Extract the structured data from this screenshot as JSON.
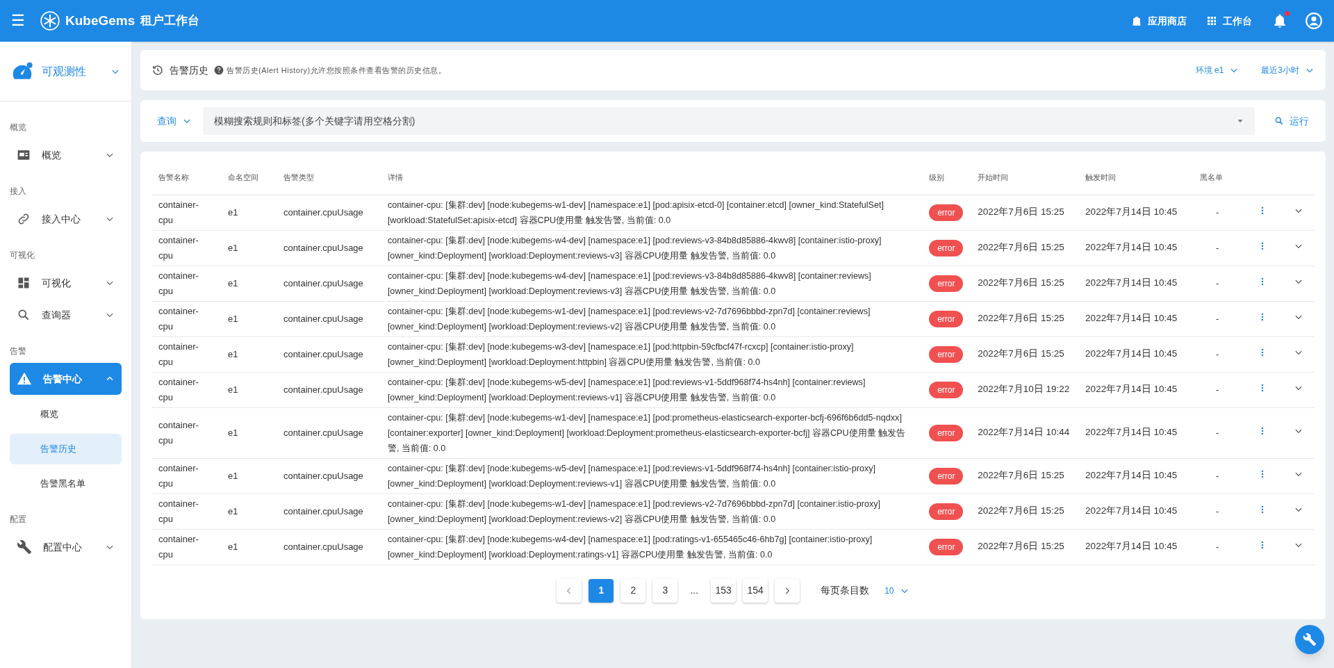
{
  "header": {
    "menu_icon": "☰",
    "logo_text": "KubeGems",
    "title": "租户工作台",
    "actions": [
      {
        "kind": "store",
        "label": "应用商店"
      },
      {
        "kind": "grid",
        "label": "工作台"
      }
    ],
    "notification_badge": true
  },
  "sidebar": {
    "module": "可观测性",
    "sections": [
      {
        "heading": "概览",
        "items": [
          {
            "kind": "overview",
            "label": "概览",
            "expanded": false
          }
        ]
      },
      {
        "heading": "接入",
        "items": [
          {
            "kind": "link",
            "label": "接入中心",
            "expanded": false
          }
        ]
      },
      {
        "heading": "可视化",
        "items": [
          {
            "kind": "dashboard",
            "label": "可视化",
            "expanded": false
          },
          {
            "kind": "search",
            "label": "查询器",
            "expanded": false
          }
        ]
      },
      {
        "heading": "告警",
        "items": [
          {
            "kind": "alert",
            "label": "告警中心",
            "expanded": true,
            "children": [
              {
                "label": "概览",
                "selected": false
              },
              {
                "label": "告警历史",
                "selected": true
              },
              {
                "label": "告警黑名单",
                "selected": false
              }
            ]
          }
        ]
      },
      {
        "heading": "配置",
        "items": [
          {
            "kind": "wrench",
            "label": "配置中心",
            "expanded": false
          }
        ]
      }
    ]
  },
  "page_header": {
    "title": "告警历史",
    "description": "告警历史(Alert History)允许您按照条件查看告警的历史信息。",
    "filters": [
      {
        "label": "环境 e1"
      },
      {
        "label": "最近3小时"
      }
    ]
  },
  "query": {
    "mode": "查询",
    "placeholder": "模糊搜索规则和标签(多个关键字请用空格分割)",
    "run_label": "运行"
  },
  "table": {
    "columns": [
      "告警名称",
      "命名空间",
      "告警类型",
      "详情",
      "级别",
      "开始时间",
      "触发时间",
      "黑名单"
    ],
    "rows": [
      {
        "name": "container-cpu",
        "namespace": "e1",
        "type": "container.cpuUsage",
        "detail": "container-cpu: [集群:dev] [node:kubegems-w1-dev] [namespace:e1] [pod:apisix-etcd-0] [container:etcd] [owner_kind:StatefulSet] [workload:StatefulSet:apisix-etcd] 容器CPU使用量 触发告警, 当前值: 0.0",
        "level": "error",
        "start": "2022年7月6日 15:25",
        "fired": "2022年7月14日 10:45",
        "blacklist": "-"
      },
      {
        "name": "container-cpu",
        "namespace": "e1",
        "type": "container.cpuUsage",
        "detail": "container-cpu: [集群:dev] [node:kubegems-w4-dev] [namespace:e1] [pod:reviews-v3-84b8d85886-4kwv8] [container:istio-proxy] [owner_kind:Deployment] [workload:Deployment:reviews-v3] 容器CPU使用量 触发告警, 当前值: 0.0",
        "level": "error",
        "start": "2022年7月6日 15:25",
        "fired": "2022年7月14日 10:45",
        "blacklist": "-"
      },
      {
        "name": "container-cpu",
        "namespace": "e1",
        "type": "container.cpuUsage",
        "detail": "container-cpu: [集群:dev] [node:kubegems-w4-dev] [namespace:e1] [pod:reviews-v3-84b8d85886-4kwv8] [container:reviews] [owner_kind:Deployment] [workload:Deployment:reviews-v3] 容器CPU使用量 触发告警, 当前值: 0.0",
        "level": "error",
        "start": "2022年7月6日 15:25",
        "fired": "2022年7月14日 10:45",
        "blacklist": "-"
      },
      {
        "name": "container-cpu",
        "namespace": "e1",
        "type": "container.cpuUsage",
        "detail": "container-cpu: [集群:dev] [node:kubegems-w1-dev] [namespace:e1] [pod:reviews-v2-7d7696bbbd-zpn7d] [container:reviews] [owner_kind:Deployment] [workload:Deployment:reviews-v2] 容器CPU使用量 触发告警, 当前值: 0.0",
        "level": "error",
        "start": "2022年7月6日 15:25",
        "fired": "2022年7月14日 10:45",
        "blacklist": "-"
      },
      {
        "name": "container-cpu",
        "namespace": "e1",
        "type": "container.cpuUsage",
        "detail": "container-cpu: [集群:dev] [node:kubegems-w3-dev] [namespace:e1] [pod:httpbin-59cfbcf47f-rcxcp] [container:istio-proxy] [owner_kind:Deployment] [workload:Deployment:httpbin] 容器CPU使用量 触发告警, 当前值: 0.0",
        "level": "error",
        "start": "2022年7月6日 15:25",
        "fired": "2022年7月14日 10:45",
        "blacklist": "-"
      },
      {
        "name": "container-cpu",
        "namespace": "e1",
        "type": "container.cpuUsage",
        "detail": "container-cpu: [集群:dev] [node:kubegems-w5-dev] [namespace:e1] [pod:reviews-v1-5ddf968f74-hs4nh] [container:reviews] [owner_kind:Deployment] [workload:Deployment:reviews-v1] 容器CPU使用量 触发告警, 当前值: 0.0",
        "level": "error",
        "start": "2022年7月10日 19:22",
        "fired": "2022年7月14日 10:45",
        "blacklist": "-"
      },
      {
        "name": "container-cpu",
        "namespace": "e1",
        "type": "container.cpuUsage",
        "detail": "container-cpu: [集群:dev] [node:kubegems-w1-dev] [namespace:e1] [pod:prometheus-elasticsearch-exporter-bcfj-696f6b6dd5-nqdxx] [container:exporter] [owner_kind:Deployment] [workload:Deployment:prometheus-elasticsearch-exporter-bcfj] 容器CPU使用量 触发告警, 当前值: 0.0",
        "level": "error",
        "start": "2022年7月14日 10:44",
        "fired": "2022年7月14日 10:45",
        "blacklist": "-"
      },
      {
        "name": "container-cpu",
        "namespace": "e1",
        "type": "container.cpuUsage",
        "detail": "container-cpu: [集群:dev] [node:kubegems-w5-dev] [namespace:e1] [pod:reviews-v1-5ddf968f74-hs4nh] [container:istio-proxy] [owner_kind:Deployment] [workload:Deployment:reviews-v1] 容器CPU使用量 触发告警, 当前值: 0.0",
        "level": "error",
        "start": "2022年7月6日 15:25",
        "fired": "2022年7月14日 10:45",
        "blacklist": "-"
      },
      {
        "name": "container-cpu",
        "namespace": "e1",
        "type": "container.cpuUsage",
        "detail": "container-cpu: [集群:dev] [node:kubegems-w1-dev] [namespace:e1] [pod:reviews-v2-7d7696bbbd-zpn7d] [container:istio-proxy] [owner_kind:Deployment] [workload:Deployment:reviews-v2] 容器CPU使用量 触发告警, 当前值: 0.0",
        "level": "error",
        "start": "2022年7月6日 15:25",
        "fired": "2022年7月14日 10:45",
        "blacklist": "-"
      },
      {
        "name": "container-cpu",
        "namespace": "e1",
        "type": "container.cpuUsage",
        "detail": "container-cpu: [集群:dev] [node:kubegems-w4-dev] [namespace:e1] [pod:ratings-v1-655465c46-6hb7g] [container:istio-proxy] [owner_kind:Deployment] [workload:Deployment:ratings-v1] 容器CPU使用量 触发告警, 当前值: 0.0",
        "level": "error",
        "start": "2022年7月6日 15:25",
        "fired": "2022年7月14日 10:45",
        "blacklist": "-"
      }
    ]
  },
  "pagination": {
    "pages": [
      {
        "label": "1",
        "selected": true
      },
      {
        "label": "2",
        "selected": false
      },
      {
        "label": "3",
        "selected": false
      },
      {
        "label": "...",
        "kind": "ellipsis"
      },
      {
        "label": "153",
        "selected": false
      },
      {
        "label": "154",
        "selected": false
      }
    ],
    "per_page_label": "每页条目数",
    "per_page": "10"
  }
}
